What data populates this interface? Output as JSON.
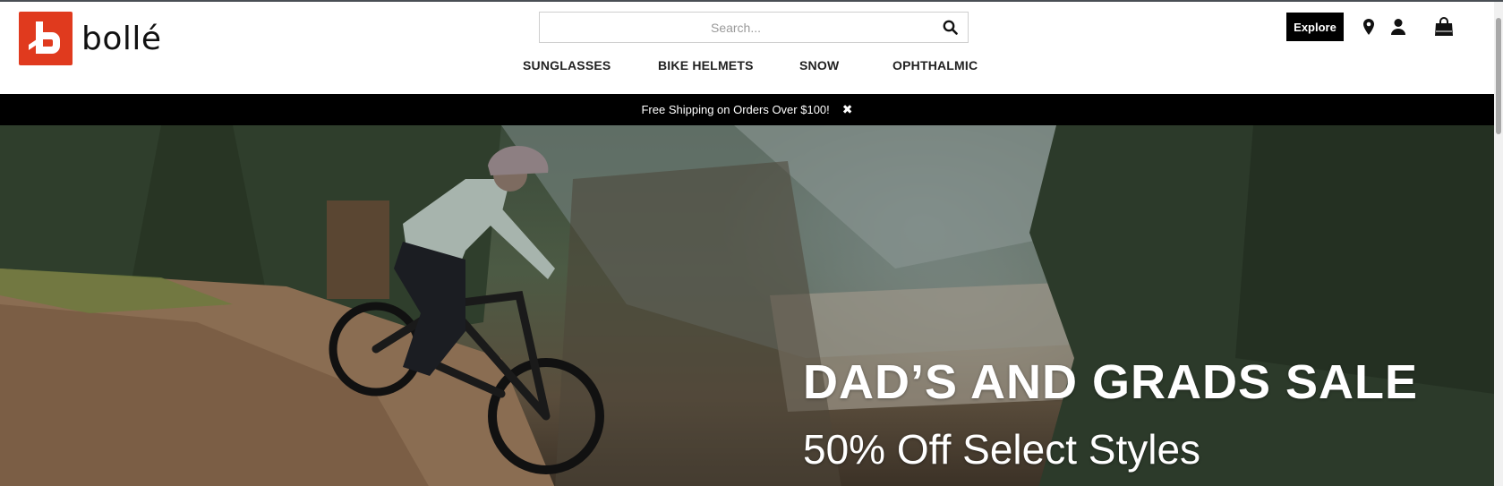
{
  "brand": {
    "logo_text": "bollé"
  },
  "search": {
    "placeholder": "Search..."
  },
  "nav": {
    "items": [
      {
        "label": "SUNGLASSES"
      },
      {
        "label": "BIKE HELMETS"
      },
      {
        "label": "SNOW"
      },
      {
        "label": "OPHTHALMIC"
      }
    ]
  },
  "header": {
    "explore_label": "Explore",
    "icons": [
      "map-pin-icon",
      "account-icon",
      "shopping-bag-icon"
    ]
  },
  "promo": {
    "text": "Free Shipping on Orders Over $100!",
    "close_glyph": "✖"
  },
  "hero": {
    "title": "DAD’S AND GRADS SALE",
    "subtitle": "50% Off Select Styles"
  },
  "colors": {
    "brand_red": "#e03a1e",
    "promo_bg": "#000000",
    "explore_bg": "#000000"
  }
}
